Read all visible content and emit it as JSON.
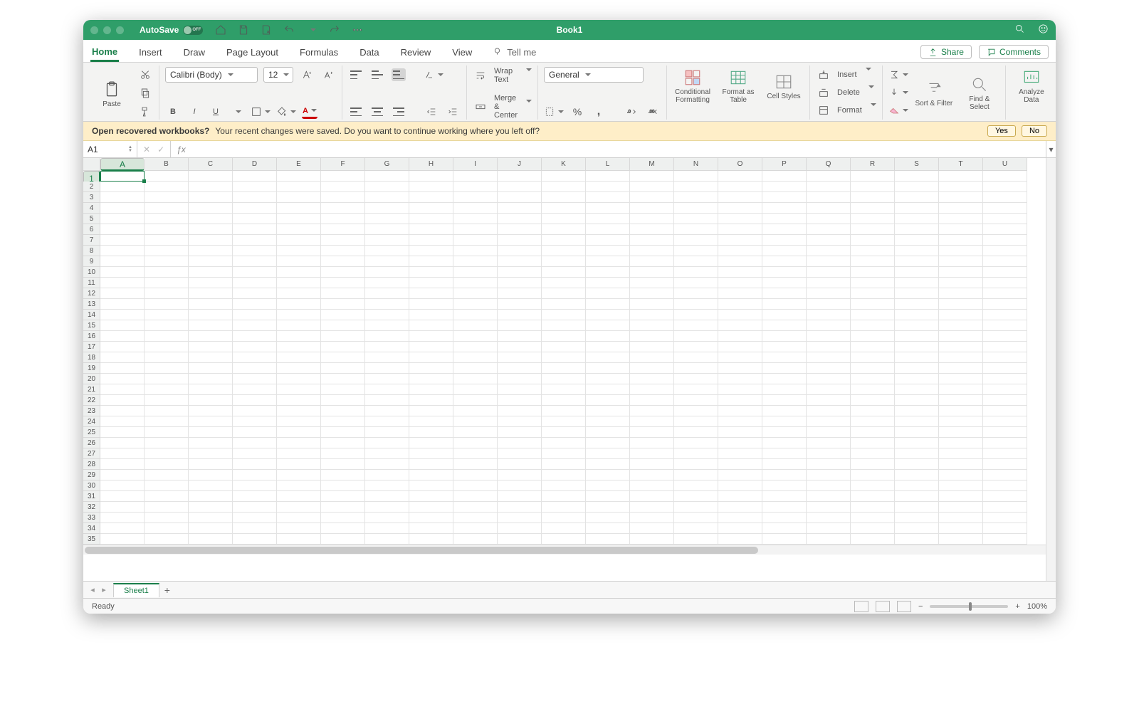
{
  "titlebar": {
    "autosave_label": "AutoSave",
    "autosave_state": "OFF",
    "title": "Book1"
  },
  "tabs": [
    "Home",
    "Insert",
    "Draw",
    "Page Layout",
    "Formulas",
    "Data",
    "Review",
    "View"
  ],
  "tellme": "Tell me",
  "share": "Share",
  "comments": "Comments",
  "ribbon": {
    "paste": "Paste",
    "font_name": "Calibri (Body)",
    "font_size": "12",
    "wrap": "Wrap Text",
    "merge": "Merge & Center",
    "number_format": "General",
    "cond": "Conditional Formatting",
    "astable": "Format as Table",
    "styles": "Cell Styles",
    "insert": "Insert",
    "delete": "Delete",
    "format": "Format",
    "sort": "Sort & Filter",
    "find": "Find & Select",
    "analyze": "Analyze Data"
  },
  "notif": {
    "heading": "Open recovered workbooks?",
    "text": "Your recent changes were saved. Do you want to continue working where you left off?",
    "yes": "Yes",
    "no": "No"
  },
  "namebox": "A1",
  "columns": [
    "A",
    "B",
    "C",
    "D",
    "E",
    "F",
    "G",
    "H",
    "I",
    "J",
    "K",
    "L",
    "M",
    "N",
    "O",
    "P",
    "Q",
    "R",
    "S",
    "T",
    "U"
  ],
  "row_count": 35,
  "sheet_tab": "Sheet1",
  "status_text": "Ready",
  "zoom": "100%"
}
